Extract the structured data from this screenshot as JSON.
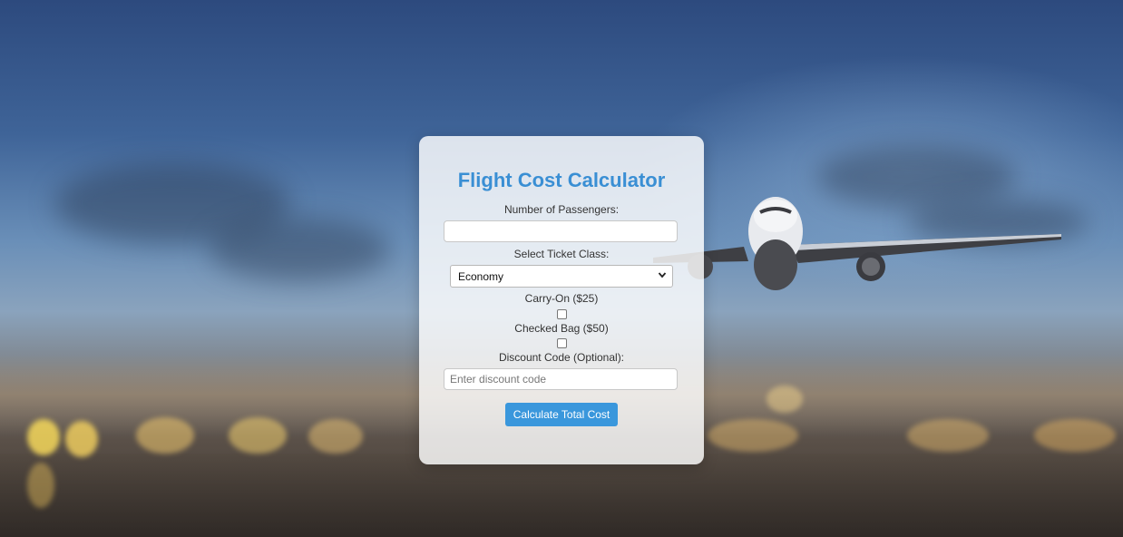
{
  "calculator": {
    "title": "Flight Cost Calculator",
    "passengers_label": "Number of Passengers:",
    "passengers_value": "",
    "ticket_class_label": "Select Ticket Class:",
    "ticket_class_selected": "Economy",
    "carry_on_label": "Carry-On ($25)",
    "carry_on_checked": false,
    "checked_bag_label": "Checked Bag ($50)",
    "checked_bag_checked": false,
    "discount_label": "Discount Code (Optional):",
    "discount_placeholder": "Enter discount code",
    "calculate_button": "Calculate Total Cost"
  },
  "colors": {
    "accent": "#3a97dc",
    "title": "#3a8fd4"
  },
  "icons": {
    "select_chevron": "chevron-down-icon",
    "background": "airplane-photo"
  }
}
